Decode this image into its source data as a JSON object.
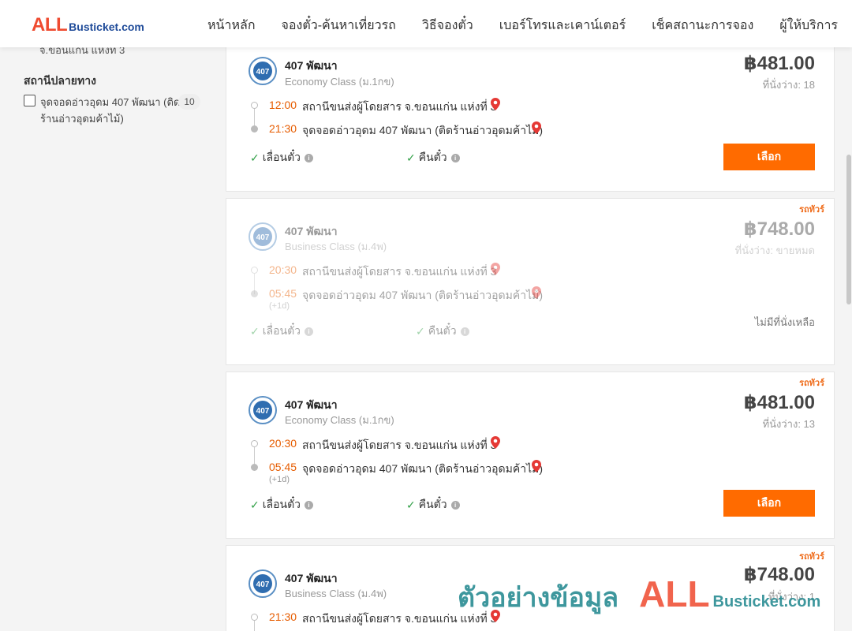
{
  "header": {
    "logo_big": "ALL",
    "logo_small": "Busticket.com",
    "nav": [
      "หน้าหลัก",
      "จองตั๋ว-ค้นหาเที่ยวรถ",
      "วิธีจองตั๋ว",
      "เบอร์โทรและเคาน์เตอร์",
      "เช็คสถานะการจอง",
      "ผู้ให้บริการ"
    ]
  },
  "sidebar": {
    "cut_text": "จ.ขอนแก่น แห่งที่ 3",
    "section_title": "สถานีปลายทาง",
    "filter_label": "จุดจอดอ่าวอุดม 407 พัฒนา (ติดร้านอ่าวอุดมค้าไม้)",
    "filter_count": "10"
  },
  "cards": [
    {
      "operator": "407 พัฒนา",
      "class": "Economy Class (ม.1กข)",
      "price": "฿481.00",
      "seats": "ที่นั่งว่าง: 18",
      "dep_time": "12:00",
      "dep_place": "สถานีขนส่งผู้โดยสาร จ.ขอนแก่น แห่งที่ 3",
      "arr_time": "21:30",
      "arr_place": "จุดจอดอ่าวอุดม 407 พัฒนา (ติดร้านอ่าวอุดมค้าไม้)",
      "opt1": "เลื่อนตั๋ว",
      "opt2": "คืนตั๋ว",
      "select": "เลือก"
    },
    {
      "badge": "รถทัวร์",
      "operator": "407 พัฒนา",
      "class": "Business Class (ม.4พ)",
      "price": "฿748.00",
      "seats": "ที่นั่งว่าง: ขายหมด",
      "dep_time": "20:30",
      "dep_place": "สถานีขนส่งผู้โดยสาร จ.ขอนแก่น แห่งที่ 3",
      "arr_time": "05:45",
      "arr_place": "จุดจอดอ่าวอุดม 407 พัฒนา (ติดร้านอ่าวอุดมค้าไม้)",
      "next_day": "(+1d)",
      "opt1": "เลื่อนตั๋ว",
      "opt2": "คืนตั๋ว",
      "no_seat": "ไม่มีที่นั่งเหลือ"
    },
    {
      "badge": "รถทัวร์",
      "operator": "407 พัฒนา",
      "class": "Economy Class (ม.1กข)",
      "price": "฿481.00",
      "seats": "ที่นั่งว่าง: 13",
      "dep_time": "20:30",
      "dep_place": "สถานีขนส่งผู้โดยสาร จ.ขอนแก่น แห่งที่ 3",
      "arr_time": "05:45",
      "arr_place": "จุดจอดอ่าวอุดม 407 พัฒนา (ติดร้านอ่าวอุดมค้าไม้)",
      "next_day": "(+1d)",
      "opt1": "เลื่อนตั๋ว",
      "opt2": "คืนตั๋ว",
      "select": "เลือก"
    },
    {
      "badge": "รถทัวร์",
      "operator": "407 พัฒนา",
      "class": "Business Class (ม.4พ)",
      "price": "฿748.00",
      "seats": "ที่นั่งว่าง: 1",
      "dep_time": "21:30",
      "dep_place": "สถานีขนส่งผู้โดยสาร จ.ขอนแก่น แห่งที่ 3"
    }
  ],
  "watermark": {
    "text": "ตัวอย่างข้อมูล",
    "all": "ALL",
    "bus": "Busticket.com"
  },
  "colors": {
    "accent": "#ff6b00",
    "time": "#e65c00",
    "check": "#2e9e44",
    "pin": "#e53935"
  }
}
